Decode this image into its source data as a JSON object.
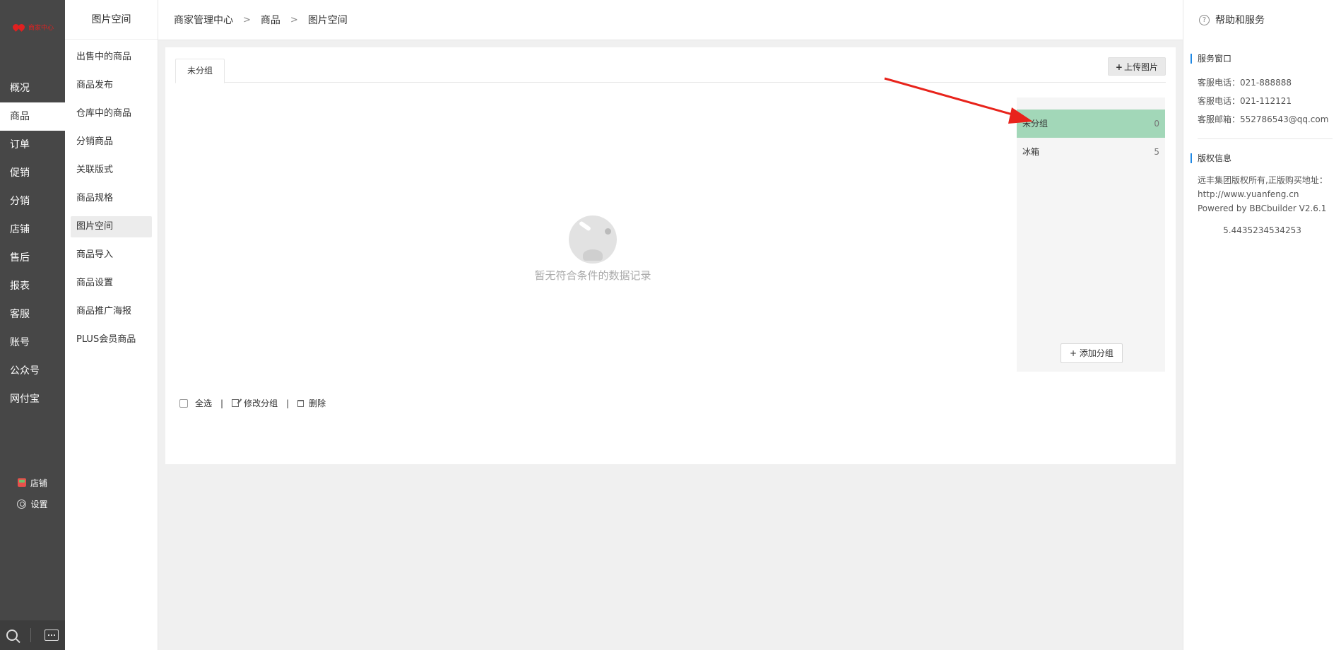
{
  "brand": {
    "logo_text": "商家中心",
    "color": "#e02020"
  },
  "main_nav": {
    "items": [
      "概况",
      "商品",
      "订单",
      "促销",
      "分销",
      "店铺",
      "售后",
      "报表",
      "客服",
      "账号",
      "公众号",
      "网付宝"
    ],
    "active": "商品",
    "bottom": [
      {
        "icon": "shop-icon",
        "label": "店铺"
      },
      {
        "icon": "gear-icon",
        "label": "设置"
      }
    ],
    "footer_icons": [
      "search-icon",
      "chat-icon"
    ]
  },
  "sub_nav": {
    "title": "图片空间",
    "items": [
      "出售中的商品",
      "商品发布",
      "仓库中的商品",
      "分销商品",
      "关联版式",
      "商品规格",
      "图片空间",
      "商品导入",
      "商品设置",
      "商品推广海报",
      "PLUS会员商品"
    ],
    "active": "图片空间"
  },
  "breadcrumb": [
    "商家管理中心",
    "商品",
    "图片空间"
  ],
  "breadcrumb_separator": ">",
  "content": {
    "tab_label": "未分组",
    "upload_button": "上传图片",
    "empty_text": "暂无符合条件的数据记录",
    "groups": [
      {
        "name": "未分组",
        "count": "0",
        "active": true
      },
      {
        "name": "冰箱",
        "count": "5",
        "active": false
      }
    ],
    "add_group_button": "+ 添加分组",
    "bottom_actions": {
      "select_all": "全选",
      "edit_group": "修改分组",
      "delete": "删除"
    },
    "active_group_color": "#a2d7b8",
    "annotation_arrow_color": "#e8231b"
  },
  "help": {
    "title": "帮助和服务",
    "service_title": "服务窗口",
    "service_lines": [
      "客服电话：021-888888",
      "客服电话：021-112121",
      "客服邮箱：552786543@qq.com"
    ],
    "copyright_title": "版权信息",
    "copyright_lines": [
      "远丰集团版权所有,正版购买地址：http://www.yuanfeng.cn",
      "Powered by BBCbuilder V2.6.1"
    ],
    "copyright_number": "5.4435234534253",
    "accent": "#1e88e5"
  }
}
